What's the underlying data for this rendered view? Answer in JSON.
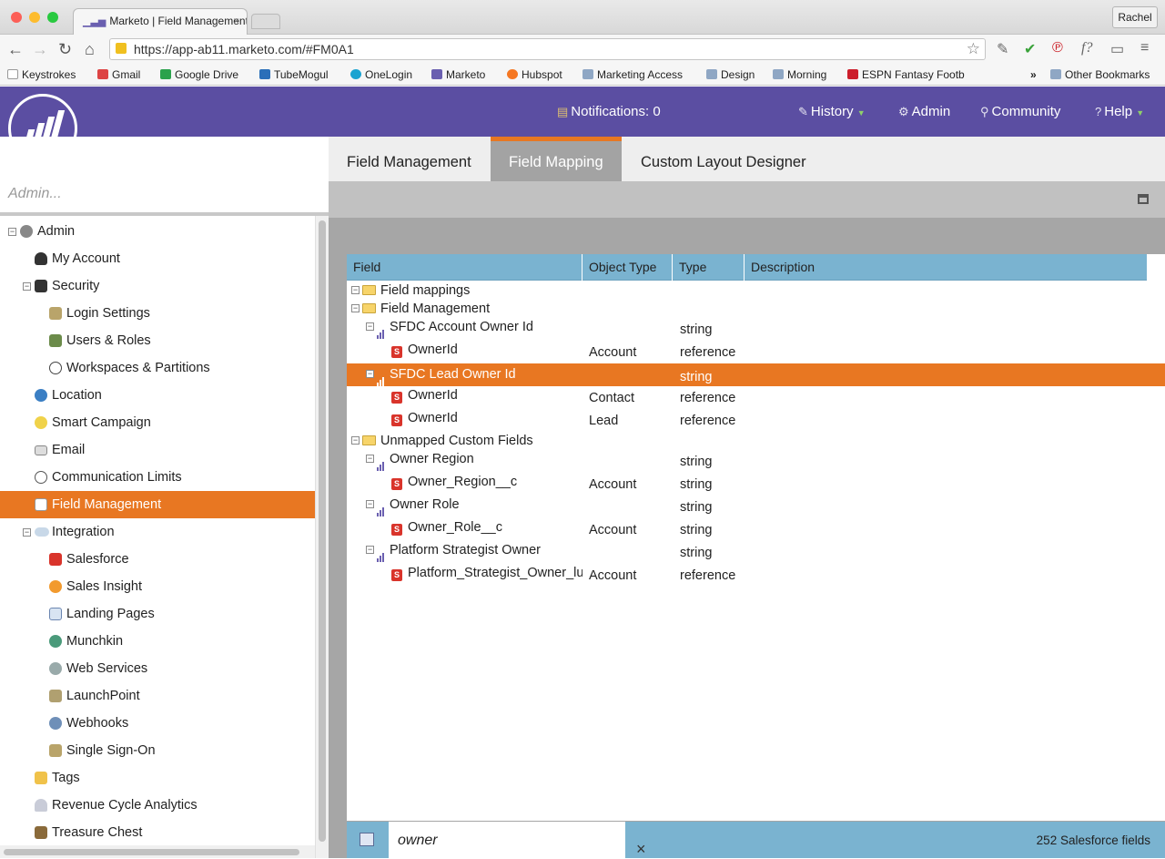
{
  "browser": {
    "tab_title": "Marketo | Field Management",
    "tab_close": "×",
    "user_label": "Rachel",
    "url": "https://app-ab11.marketo.com/#FM0A1",
    "nav_back": "←",
    "nav_forward": "→",
    "nav_reload": "↻",
    "nav_home": "⌂",
    "star": "☆",
    "bookmarks": [
      "Keystrokes",
      "Gmail",
      "Google Drive",
      "TubeMogul",
      "OneLogin",
      "Marketo",
      "Hubspot",
      "Marketing Access",
      "Design",
      "Morning",
      "ESPN Fantasy Footb",
      "Other Bookmarks"
    ],
    "bookmarks_more": "»"
  },
  "header": {
    "notifications": "Notifications: 0",
    "history": "History",
    "admin": "Admin",
    "community": "Community",
    "help": "Help"
  },
  "sidebar": {
    "search_placeholder": "Admin...",
    "items": [
      {
        "label": "Admin",
        "level": 0
      },
      {
        "label": "My Account",
        "level": 1
      },
      {
        "label": "Security",
        "level": 1
      },
      {
        "label": "Login Settings",
        "level": 2
      },
      {
        "label": "Users & Roles",
        "level": 2
      },
      {
        "label": "Workspaces & Partitions",
        "level": 2
      },
      {
        "label": "Location",
        "level": 1
      },
      {
        "label": "Smart Campaign",
        "level": 1
      },
      {
        "label": "Email",
        "level": 1
      },
      {
        "label": "Communication Limits",
        "level": 1
      },
      {
        "label": "Field Management",
        "level": 1,
        "selected": true
      },
      {
        "label": "Integration",
        "level": 1
      },
      {
        "label": "Salesforce",
        "level": 2
      },
      {
        "label": "Sales Insight",
        "level": 2
      },
      {
        "label": "Landing Pages",
        "level": 2
      },
      {
        "label": "Munchkin",
        "level": 2
      },
      {
        "label": "Web Services",
        "level": 2
      },
      {
        "label": "LaunchPoint",
        "level": 2
      },
      {
        "label": "Webhooks",
        "level": 2
      },
      {
        "label": "Single Sign-On",
        "level": 2
      },
      {
        "label": "Tags",
        "level": 1
      },
      {
        "label": "Revenue Cycle Analytics",
        "level": 1
      },
      {
        "label": "Treasure Chest",
        "level": 1
      }
    ]
  },
  "tabs": [
    "Field Management",
    "Field Mapping",
    "Custom Layout Designer"
  ],
  "grid": {
    "columns": [
      "Field",
      "Object Type",
      "Type",
      "Description"
    ],
    "rows": [
      {
        "field": "Field mappings",
        "object_type": "",
        "type": "",
        "kind": "folder"
      },
      {
        "field": "Field Management",
        "object_type": "",
        "type": "",
        "kind": "folder"
      },
      {
        "field": "SFDC Account Owner Id",
        "object_type": "",
        "type": "string",
        "kind": "field"
      },
      {
        "field": "OwnerId",
        "object_type": "Account",
        "type": "reference",
        "kind": "sfdc"
      },
      {
        "field": "SFDC Lead Owner Id",
        "object_type": "",
        "type": "string",
        "kind": "field",
        "selected": true
      },
      {
        "field": "OwnerId",
        "object_type": "Contact",
        "type": "reference",
        "kind": "sfdc"
      },
      {
        "field": "OwnerId",
        "object_type": "Lead",
        "type": "reference",
        "kind": "sfdc"
      },
      {
        "field": "Unmapped Custom Fields",
        "object_type": "",
        "type": "",
        "kind": "folder"
      },
      {
        "field": "Owner Region",
        "object_type": "",
        "type": "string",
        "kind": "field"
      },
      {
        "field": "Owner_Region__c",
        "object_type": "Account",
        "type": "string",
        "kind": "sfdc"
      },
      {
        "field": "Owner Role",
        "object_type": "",
        "type": "string",
        "kind": "field"
      },
      {
        "field": "Owner_Role__c",
        "object_type": "Account",
        "type": "string",
        "kind": "sfdc"
      },
      {
        "field": "Platform Strategist Owner",
        "object_type": "",
        "type": "string",
        "kind": "field"
      },
      {
        "field": "Platform_Strategist_Owner_lu",
        "object_type": "Account",
        "type": "reference",
        "kind": "sfdc"
      }
    ]
  },
  "footer": {
    "filter_value": "owner",
    "clear": "×",
    "count": "252 Salesforce fields"
  },
  "colors": {
    "brand_purple": "#5b4ea2",
    "accent_orange": "#e87722",
    "grid_header": "#7ab3d0"
  }
}
